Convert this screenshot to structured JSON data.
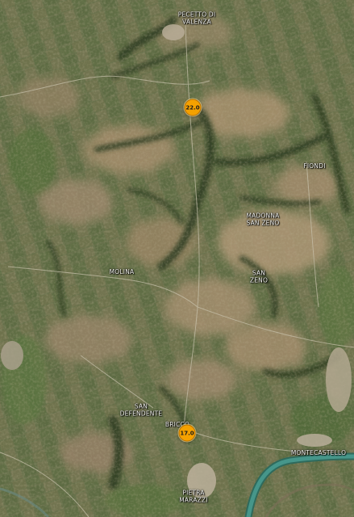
{
  "map": {
    "places": [
      {
        "id": "pecetto-di-valenza",
        "name": "PECETTO DI\nVALENZA"
      },
      {
        "id": "fiondi",
        "name": "FIONDI"
      },
      {
        "id": "madonna-san-zeno",
        "name": "MADONNA\nSAN ZENO"
      },
      {
        "id": "molina",
        "name": "MOLINA"
      },
      {
        "id": "san-zeno",
        "name": "SAN\nZENO"
      },
      {
        "id": "san-defendente",
        "name": "SAN\nDEFENDENTE"
      },
      {
        "id": "bricco",
        "name": "BRICCO"
      },
      {
        "id": "montecastello",
        "name": "MONTECASTELLO"
      },
      {
        "id": "pietra-marazzi",
        "name": "PIETRA\nMARAZZI"
      }
    ],
    "markers": [
      {
        "id": "marker-22",
        "value": "22.0"
      },
      {
        "id": "marker-17",
        "value": "17.0"
      }
    ],
    "colors": {
      "marker_fill": "#f5a100",
      "river": "#3c8a78",
      "fields_light": "#a08c6a",
      "fields_green": "#5f7245"
    }
  }
}
